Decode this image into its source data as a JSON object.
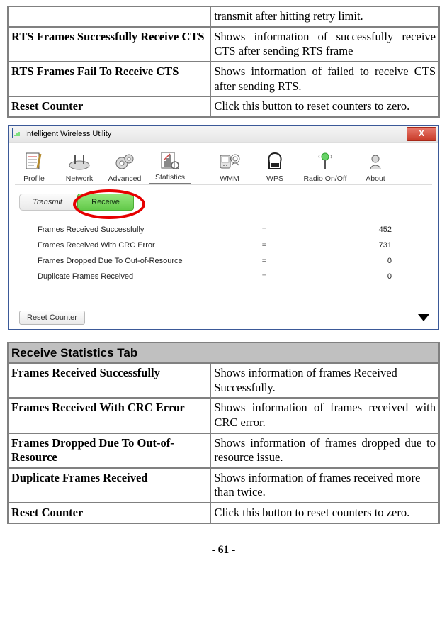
{
  "table1": {
    "rows": [
      {
        "term": "",
        "desc": "transmit after hitting retry limit."
      },
      {
        "term": "RTS Frames Successfully Receive CTS",
        "desc": "Shows information of successfully receive CTS after sending RTS frame"
      },
      {
        "term": "RTS Frames Fail To Receive CTS",
        "desc": "Shows information of failed to receive CTS after sending RTS."
      },
      {
        "term": "Reset Counter",
        "desc": "Click this button to reset counters to zero."
      }
    ]
  },
  "screenshot": {
    "window_title": "Intelligent Wireless Utility",
    "close_glyph": "X",
    "toolbar": [
      {
        "name": "profile",
        "label": "Profile"
      },
      {
        "name": "network",
        "label": "Network"
      },
      {
        "name": "advanced",
        "label": "Advanced"
      },
      {
        "name": "statistics",
        "label": "Statistics",
        "selected": true
      },
      {
        "name": "wmm",
        "label": "WMM"
      },
      {
        "name": "wps",
        "label": "WPS"
      },
      {
        "name": "radio",
        "label": "Radio On/Off"
      },
      {
        "name": "about",
        "label": "About"
      }
    ],
    "subtabs": {
      "transmit": "Transmit",
      "receive": "Receive"
    },
    "stats": [
      {
        "label": "Frames Received Successfully",
        "value": "452"
      },
      {
        "label": "Frames Received With CRC Error",
        "value": "731"
      },
      {
        "label": "Frames Dropped Due To Out-of-Resource",
        "value": "0"
      },
      {
        "label": "Duplicate Frames Received",
        "value": "0"
      }
    ],
    "reset_btn": "Reset Counter"
  },
  "table2": {
    "header": "Receive Statistics Tab",
    "rows": [
      {
        "term": "Frames Received Successfully",
        "desc": "Shows information of frames Received Successfully."
      },
      {
        "term": "Frames Received With CRC Error",
        "desc": "Shows information of frames received with CRC error."
      },
      {
        "term": "Frames Dropped Due To Out-of-Resource",
        "desc": "Shows information of frames dropped due to resource issue."
      },
      {
        "term": "Duplicate Frames Received",
        "desc": "Shows information of frames received more than twice."
      },
      {
        "term": "Reset Counter",
        "desc": "Click this button to reset counters to zero."
      }
    ]
  },
  "pagenum": "- 61 -"
}
